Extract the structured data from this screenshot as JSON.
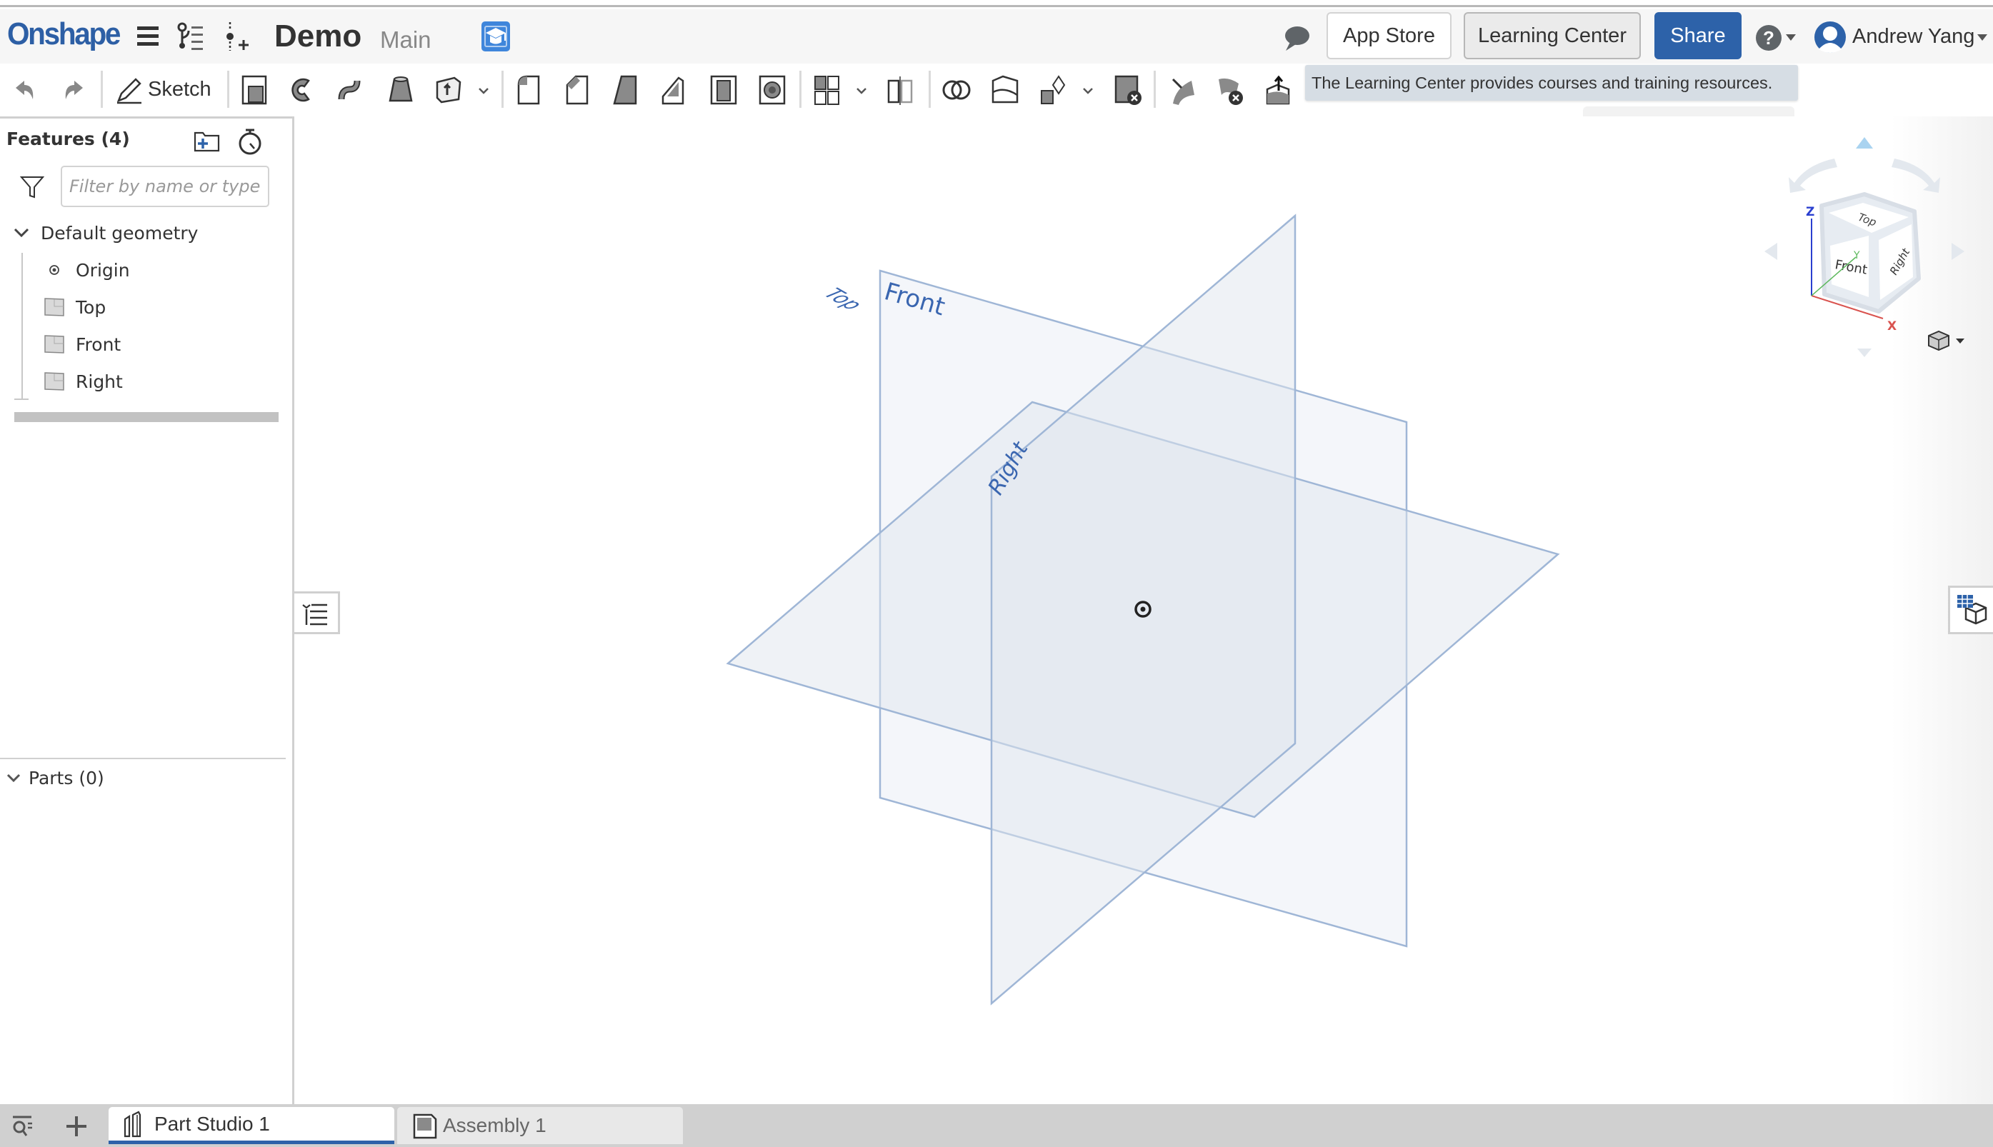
{
  "header": {
    "logo": "Onshape",
    "document_title": "Demo",
    "branch": "Main",
    "app_store_label": "App Store",
    "learning_center_label": "Learning Center",
    "share_label": "Share",
    "user_name": "Andrew Yang"
  },
  "tooltip": {
    "text": "The Learning Center provides courses and training resources."
  },
  "toolbar": {
    "sketch_label": "Sketch",
    "tools": [
      "undo",
      "redo",
      "sketch",
      "extrude",
      "revolve",
      "sweep",
      "loft",
      "thicken",
      "fillet",
      "chamfer",
      "draft",
      "rib",
      "shell",
      "hole",
      "linear-pattern",
      "mirror",
      "boolean",
      "split",
      "transform",
      "delete-part",
      "move-face",
      "delete-face",
      "offset-surface"
    ]
  },
  "feature_panel": {
    "title": "Features (4)",
    "filter_placeholder": "Filter by name or type",
    "group_label": "Default geometry",
    "items": [
      {
        "label": "Origin",
        "icon": "origin-icon"
      },
      {
        "label": "Top",
        "icon": "plane-icon"
      },
      {
        "label": "Front",
        "icon": "plane-icon"
      },
      {
        "label": "Right",
        "icon": "plane-icon"
      }
    ],
    "parts_label": "Parts (0)"
  },
  "viewport": {
    "planes": [
      {
        "name": "Front",
        "label": "Front"
      },
      {
        "name": "Top",
        "label": "Top"
      },
      {
        "name": "Right",
        "label": "Right"
      }
    ],
    "view_cube": {
      "faces": [
        "Top",
        "Front",
        "Right"
      ],
      "axes": [
        "X",
        "Y",
        "Z"
      ],
      "axis_colors": {
        "x": "#d9534f",
        "y": "#5cb85c",
        "z": "#2a3fcf"
      }
    }
  },
  "bottom_tabs": {
    "tabs": [
      {
        "label": "Part Studio 1",
        "active": true
      },
      {
        "label": "Assembly 1",
        "active": false
      }
    ]
  },
  "colors": {
    "brand": "#2d5fa5",
    "share_button": "#2d62a9",
    "plane_stroke": "#9fb6d6",
    "plane_label": "#3a66b0",
    "tooltip_bg": "#d6dde4"
  }
}
